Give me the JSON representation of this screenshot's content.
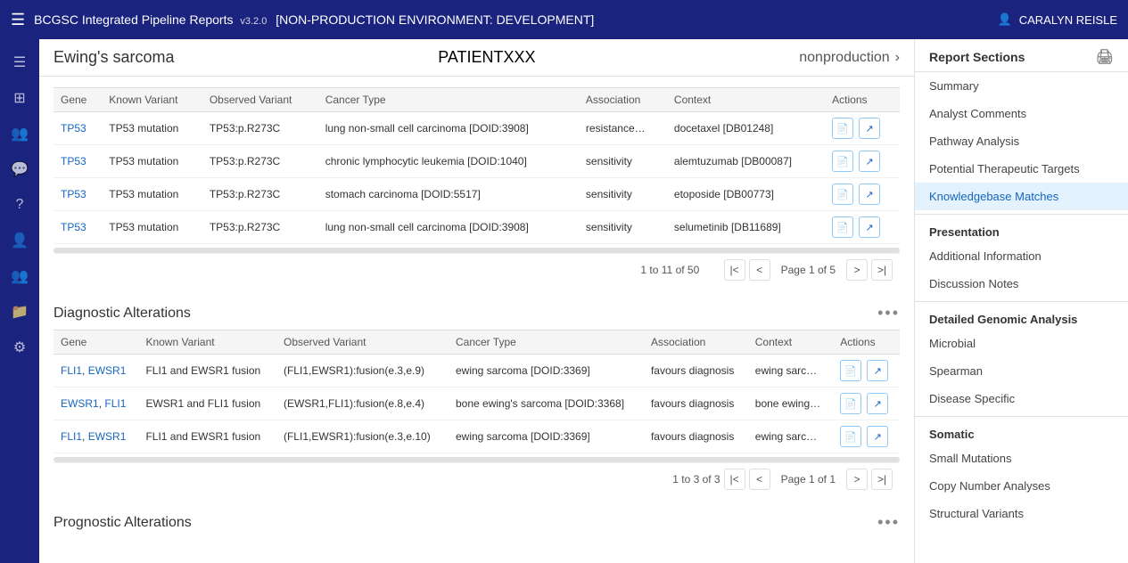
{
  "topbar": {
    "menu_icon": "☰",
    "title": "BCGSC Integrated Pipeline Reports",
    "version": "v3.2.0",
    "env_label": "[NON-PRODUCTION ENVIRONMENT: DEVELOPMENT]",
    "user_icon": "👤",
    "username": "CARALYN REISLE"
  },
  "left_nav": {
    "icons": [
      {
        "name": "menu-icon",
        "glyph": "☰"
      },
      {
        "name": "dashboard-icon",
        "glyph": "⊞"
      },
      {
        "name": "reports-icon",
        "glyph": "👥"
      },
      {
        "name": "comments-icon",
        "glyph": "💬"
      },
      {
        "name": "help-icon",
        "glyph": "?"
      },
      {
        "name": "user-icon",
        "glyph": "👤"
      },
      {
        "name": "group-icon",
        "glyph": "👥"
      },
      {
        "name": "file-icon",
        "glyph": "📁"
      },
      {
        "name": "settings-icon",
        "glyph": "⚙"
      }
    ]
  },
  "report": {
    "title": "Ewing's sarcoma",
    "patient": "PATIENTXXX",
    "environment": "nonproduction",
    "chevron": "›"
  },
  "knowledgebase_table": {
    "section_title": "",
    "columns": [
      "Gene",
      "Known Variant",
      "Observed Variant",
      "Cancer Type",
      "Association",
      "Context",
      "Actions"
    ],
    "rows": [
      {
        "gene": "TP53",
        "known_variant": "TP53 mutation",
        "observed_variant": "TP53:p.R273C",
        "cancer_type": "lung non-small cell carcinoma [DOID:3908]",
        "association": "resistance…",
        "context": "docetaxel [DB01248]"
      },
      {
        "gene": "TP53",
        "known_variant": "TP53 mutation",
        "observed_variant": "TP53:p.R273C",
        "cancer_type": "chronic lymphocytic leukemia [DOID:1040]",
        "association": "sensitivity",
        "context": "alemtuzumab [DB00087]"
      },
      {
        "gene": "TP53",
        "known_variant": "TP53 mutation",
        "observed_variant": "TP53:p.R273C",
        "cancer_type": "stomach carcinoma [DOID:5517]",
        "association": "sensitivity",
        "context": "etoposide [DB00773]"
      },
      {
        "gene": "TP53",
        "known_variant": "TP53 mutation",
        "observed_variant": "TP53:p.R273C",
        "cancer_type": "lung non-small cell carcinoma [DOID:3908]",
        "association": "sensitivity",
        "context": "selumetinib [DB11689]"
      }
    ],
    "pagination": {
      "range": "1 to 11 of 50",
      "page_label": "Page 1 of 5"
    }
  },
  "diagnostic_table": {
    "section_title": "Diagnostic Alterations",
    "columns": [
      "Gene",
      "Known Variant",
      "Observed Variant",
      "Cancer Type",
      "Association",
      "Context",
      "Actions"
    ],
    "rows": [
      {
        "genes": [
          "FLI1",
          "EWSR1"
        ],
        "known_variant": "FLI1 and EWSR1 fusion",
        "observed_variant": "(FLI1,EWSR1):fusion(e.3,e.9)",
        "cancer_type": "ewing sarcoma [DOID:3369]",
        "association": "favours diagnosis",
        "context": "ewing sarc…"
      },
      {
        "genes": [
          "EWSR1",
          "FLI1"
        ],
        "known_variant": "EWSR1 and FLI1 fusion",
        "observed_variant": "(EWSR1,FLI1):fusion(e.8,e.4)",
        "cancer_type": "bone ewing's sarcoma [DOID:3368]",
        "association": "favours diagnosis",
        "context": "bone ewing…"
      },
      {
        "genes": [
          "FLI1",
          "EWSR1"
        ],
        "known_variant": "FLI1 and EWSR1 fusion",
        "observed_variant": "(FLI1,EWSR1):fusion(e.3,e.10)",
        "cancer_type": "ewing sarcoma [DOID:3369]",
        "association": "favours diagnosis",
        "context": "ewing sarc…"
      }
    ],
    "pagination": {
      "range": "1 to 3 of 3",
      "page_label": "Page 1 of 1"
    }
  },
  "prognostic": {
    "section_title": "Prognostic Alterations"
  },
  "right_sidebar": {
    "header": "Report Sections",
    "print_icon": "🖨",
    "items_top": [
      {
        "label": "Summary",
        "active": false
      },
      {
        "label": "Analyst Comments",
        "active": false
      },
      {
        "label": "Pathway Analysis",
        "active": false
      },
      {
        "label": "Potential Therapeutic Targets",
        "active": false
      },
      {
        "label": "Knowledgebase Matches",
        "active": true
      }
    ],
    "group_presentation": "Presentation",
    "items_presentation": [
      {
        "label": "Additional Information",
        "active": false
      },
      {
        "label": "Discussion Notes",
        "active": false
      }
    ],
    "group_genomic": "Detailed Genomic Analysis",
    "items_genomic": [
      {
        "label": "Microbial",
        "active": false
      },
      {
        "label": "Spearman",
        "active": false
      },
      {
        "label": "Disease Specific",
        "active": false
      }
    ],
    "group_somatic": "Somatic",
    "items_somatic": [
      {
        "label": "Small Mutations",
        "active": false
      },
      {
        "label": "Copy Number Analyses",
        "active": false
      },
      {
        "label": "Structural Variants",
        "active": false
      }
    ]
  }
}
